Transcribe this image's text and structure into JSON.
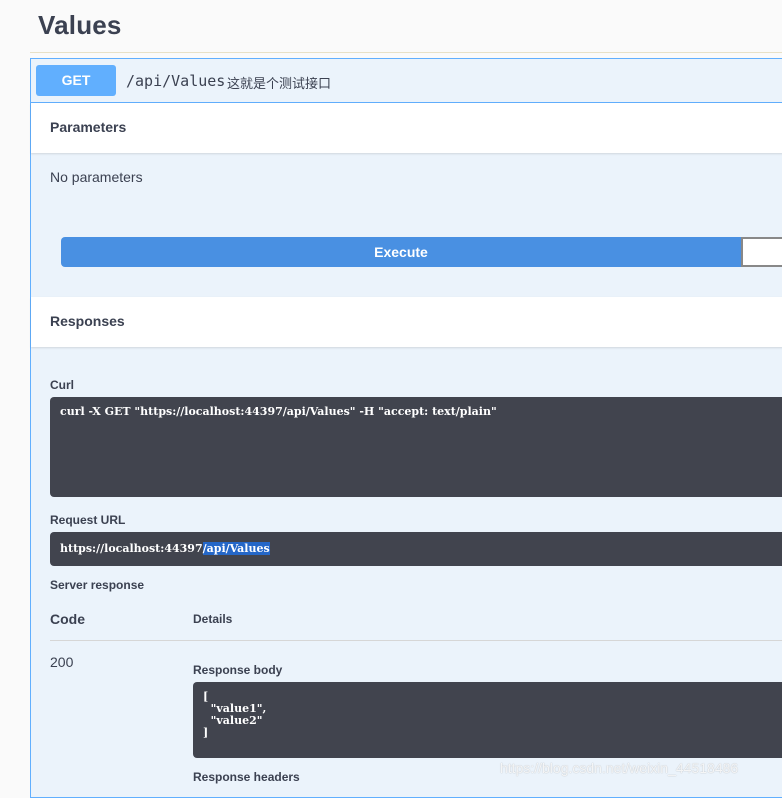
{
  "page": {
    "title": "Values"
  },
  "operation": {
    "method": "GET",
    "path": "/api/Values",
    "description": "这就是个测试接口"
  },
  "parameters": {
    "header": "Parameters",
    "empty_text": "No parameters",
    "execute_label": "Execute"
  },
  "responses": {
    "header": "Responses",
    "curl_label": "Curl",
    "curl_command": "curl -X GET \"https://localhost:44397/api/Values\" -H \"accept: text/plain\"",
    "request_url_label": "Request URL",
    "request_url_base": "https://localhost:44397",
    "request_url_path": "/api/Values",
    "server_response_label": "Server response",
    "col_code": "Code",
    "col_details": "Details",
    "status_code": "200",
    "response_body_label": "Response body",
    "response_body": "[\n  \"value1\",\n  \"value2\"\n]",
    "response_headers_label": "Response headers"
  },
  "watermark": "https://blog.csdn.net/weixin_44518486",
  "colors": {
    "get_accent": "#61affe",
    "execute_button": "#4990e2",
    "code_background": "#41444e",
    "selection_highlight": "#2467c8"
  }
}
